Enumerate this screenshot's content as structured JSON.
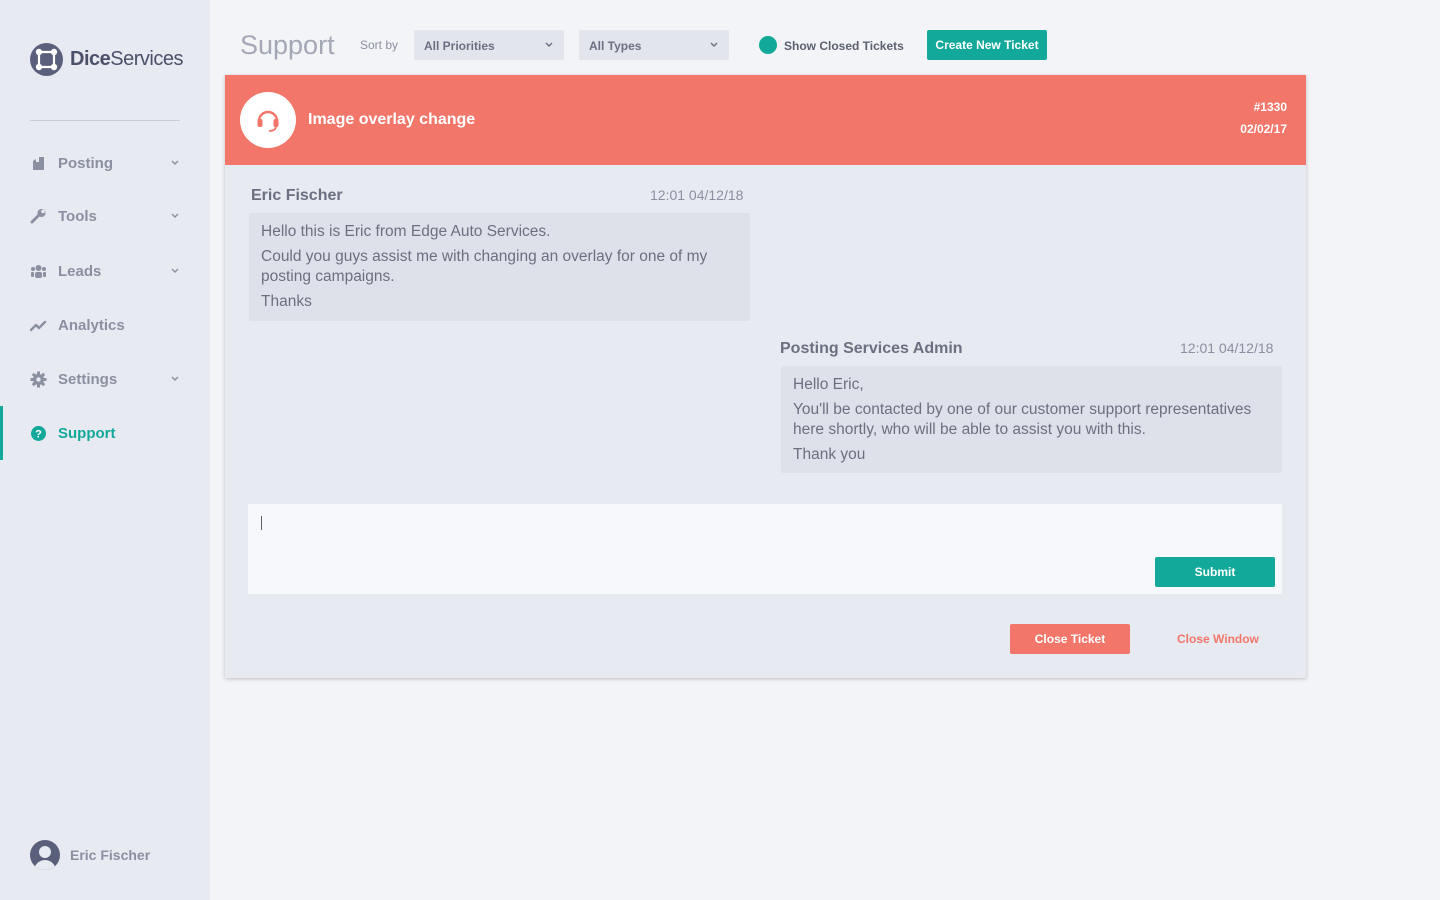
{
  "brand": {
    "name_bold": "Dice",
    "name_rest": "Services"
  },
  "sidebar": {
    "items": [
      {
        "label": "Posting",
        "icon": "posting-icon",
        "has_chevron": true
      },
      {
        "label": "Tools",
        "icon": "wrench-icon",
        "has_chevron": true
      },
      {
        "label": "Leads",
        "icon": "people-icon",
        "has_chevron": true
      },
      {
        "label": "Analytics",
        "icon": "trend-icon",
        "has_chevron": false
      },
      {
        "label": "Settings",
        "icon": "gear-icon",
        "has_chevron": true
      },
      {
        "label": "Support",
        "icon": "help-icon",
        "has_chevron": false,
        "active": true
      }
    ],
    "user": {
      "name": "Eric Fischer"
    }
  },
  "header": {
    "title": "Support",
    "sort_label": "Sort by",
    "priority_select": "All Priorities",
    "type_select": "All Types",
    "show_closed_label": "Show Closed Tickets",
    "create_button": "Create New Ticket"
  },
  "ticket": {
    "title": "Image overlay change",
    "id": "#1330",
    "date": "02/02/17",
    "messages": [
      {
        "author": "Eric Fischer",
        "time": "12:01  04/12/18",
        "lines": [
          "Hello this is Eric from Edge Auto Services.",
          "Could you guys assist me with changing an overlay for one of my posting campaigns.",
          "Thanks"
        ]
      },
      {
        "author": "Posting Services Admin",
        "time": "12:01  04/12/18",
        "lines": [
          "Hello Eric,",
          "You'll be contacted by one of our customer support representatives here shortly, who will be able to assist you with this.",
          "Thank you"
        ]
      }
    ],
    "reply": {
      "value": "",
      "submit_label": "Submit"
    },
    "close_ticket_label": "Close Ticket",
    "close_window_label": "Close Window"
  },
  "colors": {
    "accent": "#12a99a",
    "alert": "#f27669",
    "sidebar_bg": "#e8eaf1"
  }
}
